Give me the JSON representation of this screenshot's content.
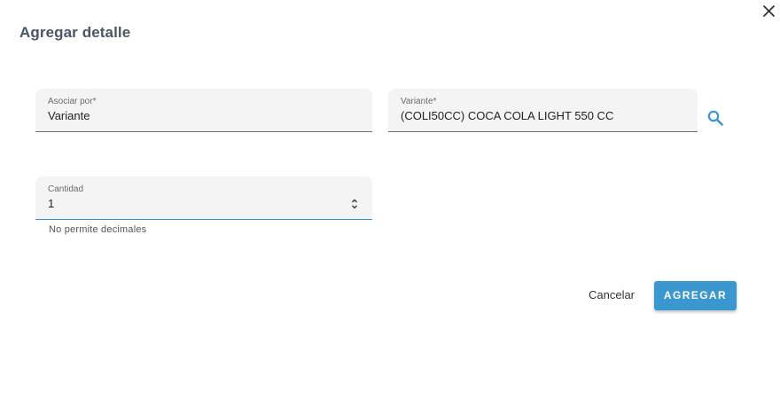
{
  "dialog": {
    "title": "Agregar detalle"
  },
  "form": {
    "asociar_por": {
      "label": "Asociar por*",
      "value": "Variante"
    },
    "variante": {
      "label": "Variante*",
      "value": "(COLI50CC) COCA COLA LIGHT 550 CC"
    },
    "cantidad": {
      "label": "Cantidad",
      "value": "1",
      "hint": "No permite decimales"
    }
  },
  "actions": {
    "cancel_label": "Cancelar",
    "submit_label": "AGREGAR"
  },
  "icons": {
    "close": "close-icon",
    "search": "search-icon",
    "stepper": "stepper-arrows-icon"
  },
  "colors": {
    "accent": "#3b97cf",
    "field_bg": "#f4f4f4",
    "title": "#4a5568"
  }
}
